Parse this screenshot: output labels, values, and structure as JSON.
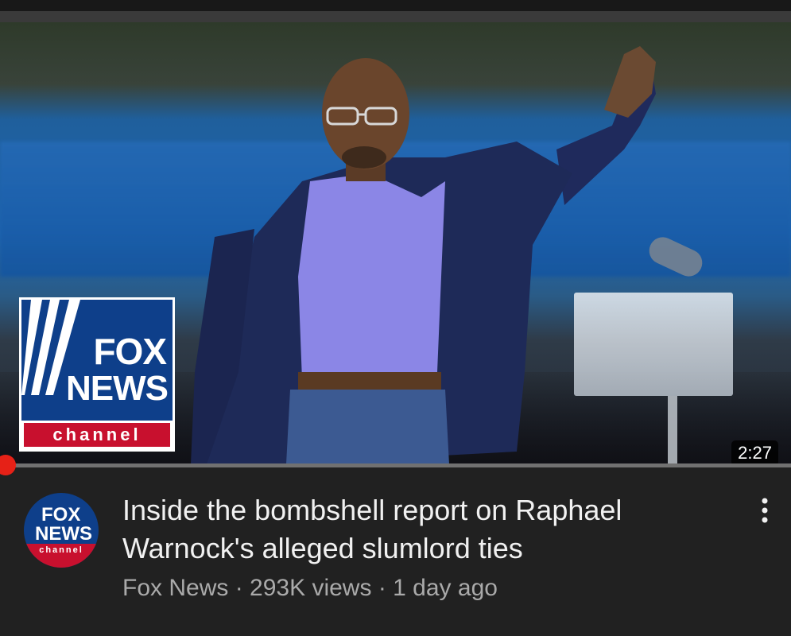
{
  "video": {
    "duration": "2:27",
    "progress": 0.01,
    "thumbnail_logo": {
      "word1": "FOX",
      "word2": "NEWS",
      "bar": "channel"
    }
  },
  "channel": {
    "avatar_logo": {
      "word1": "FOX",
      "word2": "NEWS",
      "bar": "channel"
    }
  },
  "details": {
    "title": "Inside the bombshell report on Raphael Warnock's alleged slumlord ties",
    "channel_name": "Fox News",
    "views": "293K views",
    "age": "1 day ago",
    "separator": "·"
  },
  "icons": {
    "more": "more-vert-icon"
  },
  "colors": {
    "background": "#212121",
    "progress_red": "#ff0000",
    "fox_blue": "#0e3f8a",
    "fox_red": "#c8102e"
  }
}
